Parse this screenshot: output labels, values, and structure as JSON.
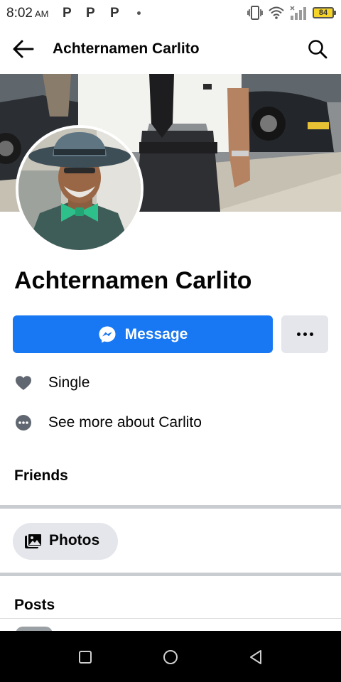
{
  "status_bar": {
    "time": "8:02",
    "ampm": "AM",
    "notification_glyph": "P",
    "battery": "84"
  },
  "header": {
    "title": "Achternamen Carlito"
  },
  "profile": {
    "name": "Achternamen Carlito"
  },
  "actions": {
    "message_label": "Message"
  },
  "info": {
    "relationship": "Single",
    "see_more": "See more about Carlito"
  },
  "sections": {
    "friends": "Friends",
    "photos": "Photos",
    "posts": "Posts"
  },
  "colors": {
    "accent": "#1877f2",
    "chip_bg": "#e4e6eb",
    "divider": "#c9ccd1"
  },
  "icons": [
    "back-arrow-icon",
    "search-icon",
    "messenger-icon",
    "more-dots-icon",
    "heart-icon",
    "more-circle-icon",
    "photos-icon",
    "recents-icon",
    "home-icon",
    "back-triangle-icon"
  ]
}
